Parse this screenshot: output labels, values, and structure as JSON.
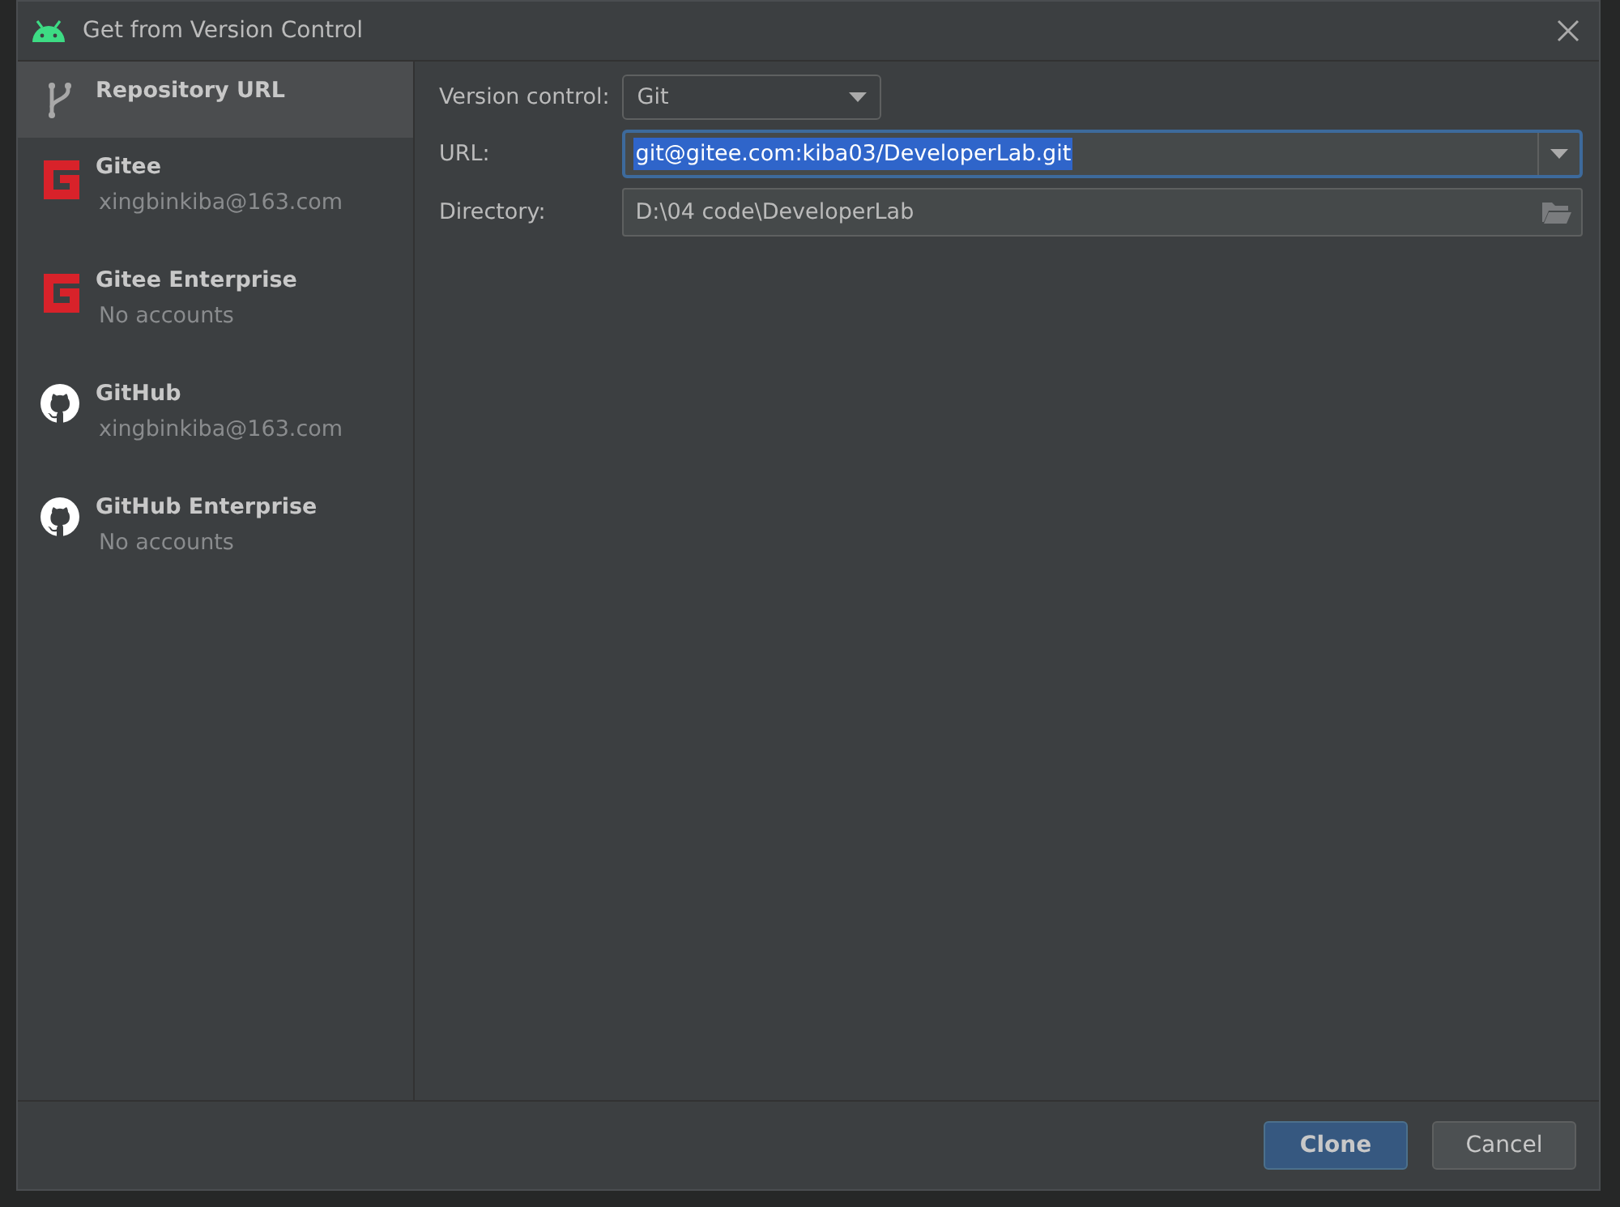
{
  "window": {
    "title": "Get from Version Control"
  },
  "sidebar": {
    "items": [
      {
        "kind": "repository",
        "label": "Repository URL",
        "selected": true
      },
      {
        "kind": "gitee",
        "label": "Gitee",
        "account": "xingbinkiba@163.com",
        "selected": false
      },
      {
        "kind": "gitee",
        "label": "Gitee Enterprise",
        "account": "No accounts",
        "selected": false
      },
      {
        "kind": "github",
        "label": "GitHub",
        "account": "xingbinkiba@163.com",
        "selected": false
      },
      {
        "kind": "github",
        "label": "GitHub Enterprise",
        "account": "No accounts",
        "selected": false
      }
    ]
  },
  "form": {
    "version_control": {
      "label": "Version control:",
      "value": "Git"
    },
    "url": {
      "label": "URL:",
      "value": "git@gitee.com:kiba03/DeveloperLab.git",
      "focused": true
    },
    "directory": {
      "label": "Directory:",
      "value": "D:\\04 code\\DeveloperLab"
    }
  },
  "buttons": [
    {
      "label": "Clone",
      "primary": true
    },
    {
      "label": "Cancel",
      "primary": false
    }
  ]
}
